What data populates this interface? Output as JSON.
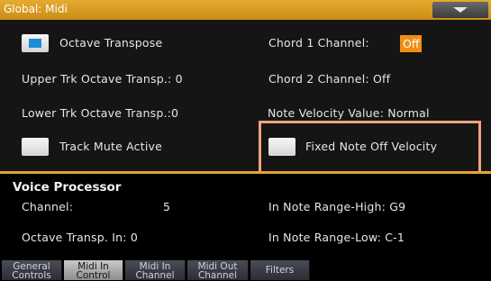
{
  "header": {
    "title": "Global: Midi"
  },
  "settings": {
    "octave_transpose": "Octave Transpose",
    "upper_trk": "Upper Trk Octave Transp.: 0",
    "lower_trk": "Lower Trk Octave Transp.:0",
    "track_mute": "Track Mute Active",
    "chord1_label": "Chord 1 Channel:",
    "chord1_value": "Off",
    "chord2": "Chord 2 Channel:  Off",
    "note_velocity": "Note Velocity Value: Normal",
    "fixed_note_off": "Fixed Note Off Velocity"
  },
  "voice": {
    "title": "Voice Processor",
    "channel_label": "Channel:",
    "channel_value": "5",
    "octave_in": "Octave Transp. In: 0",
    "range_high": "In Note Range-High:  G9",
    "range_low": "In Note Range-Low:   C-1"
  },
  "tabs": [
    {
      "line1": "General",
      "line2": "Controls"
    },
    {
      "line1": "Midi In",
      "line2": "Control"
    },
    {
      "line1": "Midi In",
      "line2": "Channel"
    },
    {
      "line1": "Midi Out",
      "line2": "Channel"
    },
    {
      "line1": "Filters",
      "line2": ""
    }
  ],
  "state": {
    "octave_transpose_checked": true,
    "track_mute_checked": false,
    "fixed_note_off_checked": false,
    "active_tab": "Midi In Control"
  },
  "colors": {
    "accent": "#e3a431",
    "checkbox_fill": "#1d8ed6",
    "highlight": "#f1a27c",
    "value_bg": "#ef8e15"
  }
}
